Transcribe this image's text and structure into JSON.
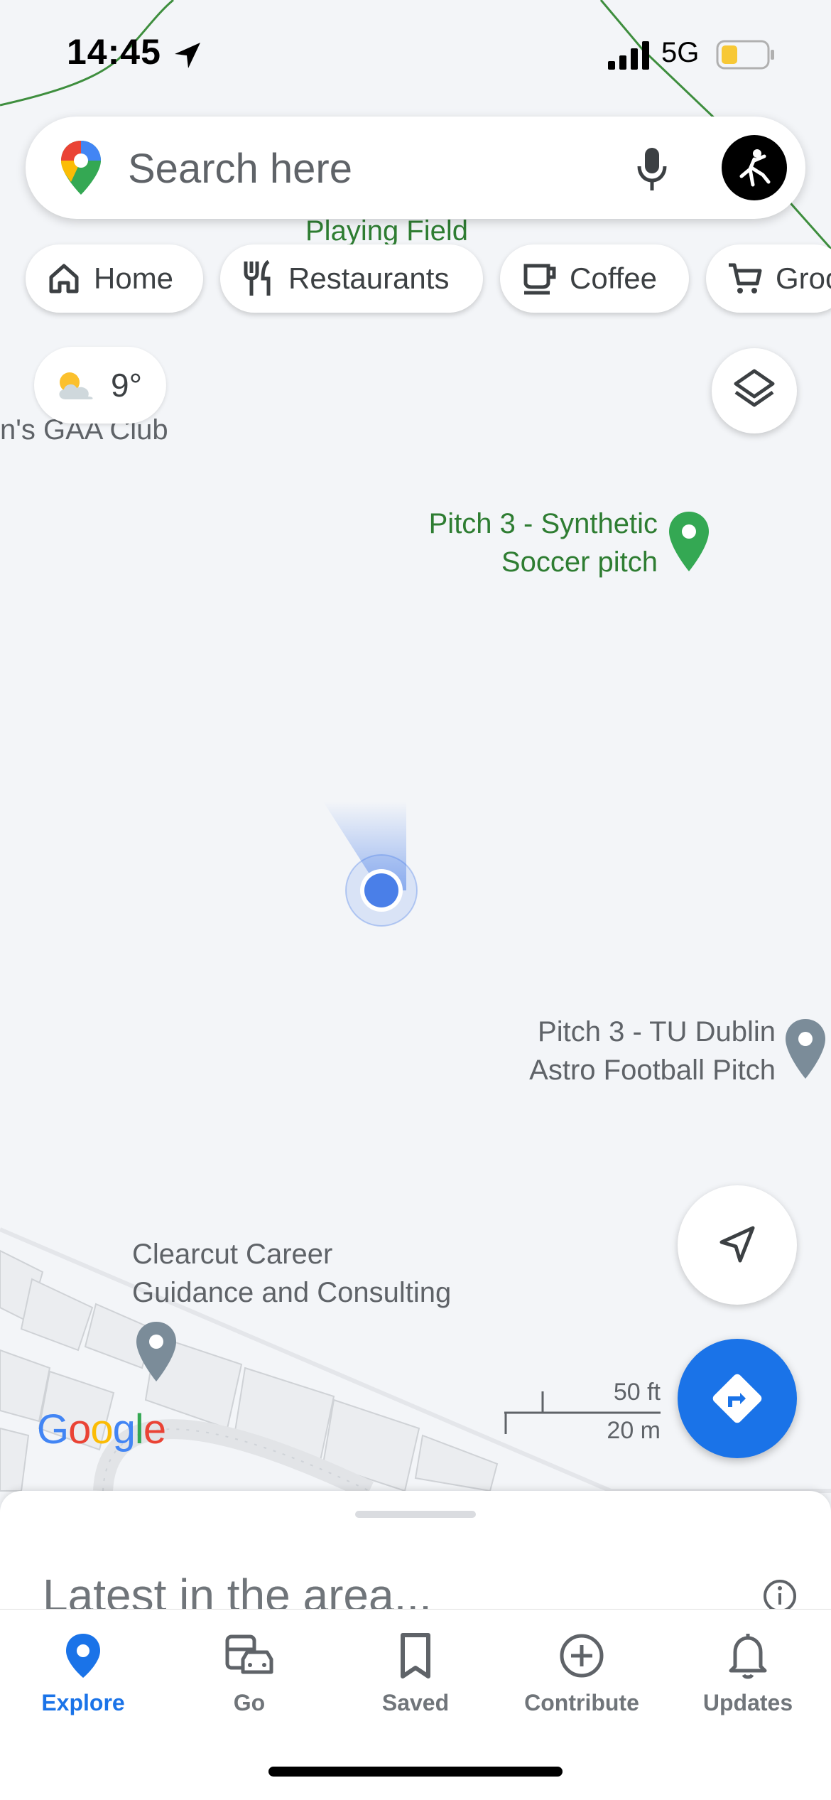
{
  "status": {
    "time": "14:45",
    "network": "5G"
  },
  "search": {
    "placeholder": "Search here"
  },
  "chips": [
    {
      "label": "Home",
      "icon": "home-icon"
    },
    {
      "label": "Restaurants",
      "icon": "restaurant-icon"
    },
    {
      "label": "Coffee",
      "icon": "coffee-icon"
    },
    {
      "label": "Groc",
      "icon": "shopping-cart-icon"
    }
  ],
  "weather": {
    "temp": "9°",
    "icon": "partly-cloudy-icon"
  },
  "map_labels": {
    "playing_field": "Playing Field",
    "gaa_club": "n's GAA Club",
    "pitch_synthetic": [
      "Pitch 3 - Synthetic",
      "Soccer pitch"
    ],
    "pitch_astro": [
      "Pitch 3 - TU Dublin",
      "Astro Football Pitch"
    ],
    "clearcut": [
      "Clearcut Career",
      "Guidance and Consulting"
    ]
  },
  "scale": {
    "imperial": "50 ft",
    "metric": "20 m"
  },
  "logo": "Google",
  "sheet": {
    "title": "Latest in the area..."
  },
  "nav": [
    {
      "label": "Explore",
      "icon": "explore-pin-icon",
      "active": true
    },
    {
      "label": "Go",
      "icon": "car-bus-icon",
      "active": false
    },
    {
      "label": "Saved",
      "icon": "bookmark-icon",
      "active": false
    },
    {
      "label": "Contribute",
      "icon": "plus-circle-icon",
      "active": false
    },
    {
      "label": "Updates",
      "icon": "bell-icon",
      "active": false
    }
  ],
  "colors": {
    "accent": "#1a73e8",
    "park_green": "#2e7d32",
    "map_bg": "#f3f5f8"
  }
}
